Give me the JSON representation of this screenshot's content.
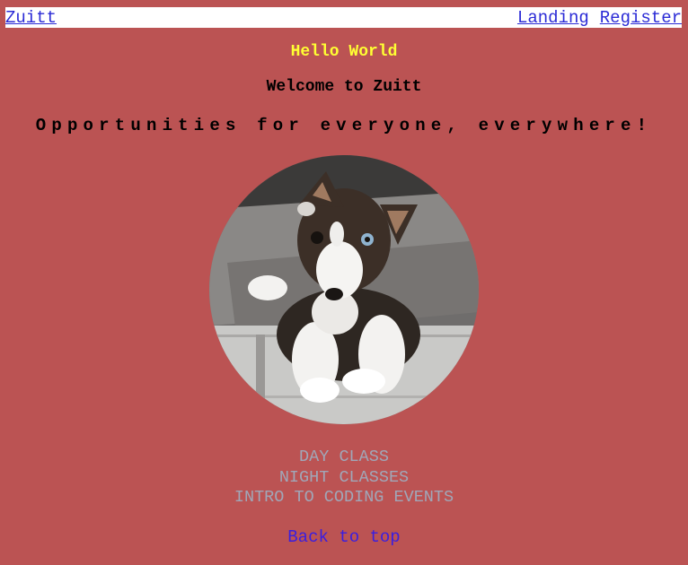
{
  "nav": {
    "brand": "Zuitt",
    "links": [
      "Landing",
      "Register"
    ]
  },
  "hero": {
    "hello": "Hello World",
    "welcome": "Welcome to Zuitt",
    "tagline": "Opportunities for everyone, everywhere!"
  },
  "image": {
    "alt": "husky puppy lying on a floor mat",
    "icon": "puppy-photo"
  },
  "classes": [
    "DAY CLASS",
    "NIGHT CLASSES",
    "INTRO TO CODING EVENTS"
  ],
  "footer": {
    "back_to_top": "Back to top"
  },
  "colors": {
    "page_background": "#bb5353",
    "hello_text": "#ffff33",
    "link": "#2b2bd6",
    "class_list_text": "#a0a7b8",
    "back_link": "#3a1ee0"
  }
}
